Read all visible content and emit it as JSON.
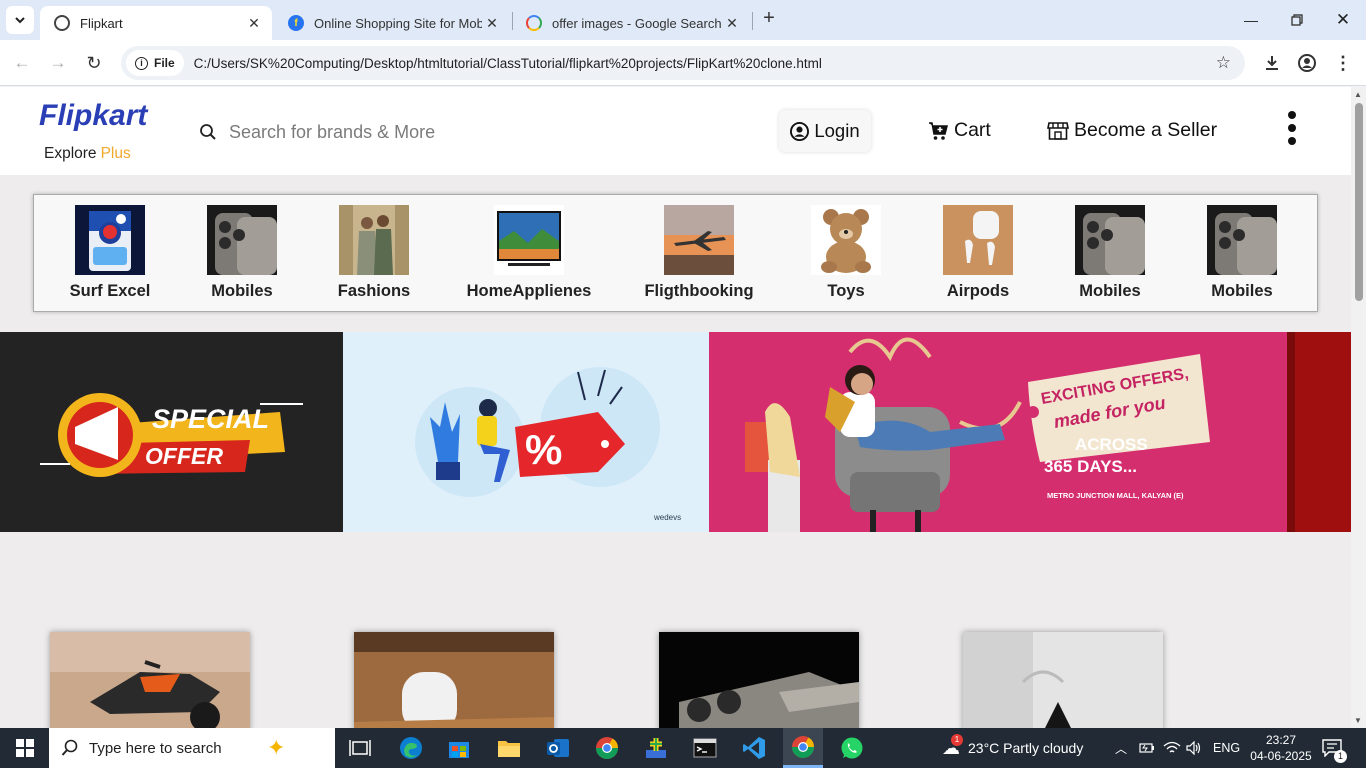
{
  "browser": {
    "tabs": [
      {
        "title": "Flipkart",
        "active": true
      },
      {
        "title": "Online Shopping Site for Mobile",
        "active": false
      },
      {
        "title": "offer images - Google Search",
        "active": false
      }
    ],
    "address": {
      "chip_label": "File",
      "url": "C:/Users/SK%20Computing/Desktop/htmltutorial/ClassTutorial/flipkart%20projects/FlipKart%20clone.html"
    }
  },
  "site": {
    "logo": "Flipkart",
    "explore": "Explore",
    "plus": "Plus",
    "search_placeholder": "Search for brands & More",
    "login_label": "Login",
    "cart_label": "Cart",
    "seller_label": "Become a Seller",
    "categories": [
      {
        "label": "Surf Excel"
      },
      {
        "label": "Mobiles"
      },
      {
        "label": "Fashions"
      },
      {
        "label": "HomeApplienes"
      },
      {
        "label": "Fligthbooking"
      },
      {
        "label": "Toys"
      },
      {
        "label": "Airpods"
      },
      {
        "label": "Mobiles"
      },
      {
        "label": "Mobiles"
      }
    ],
    "banners": {
      "special_line1": "SPECIAL",
      "special_line2": "OFFER",
      "discount_symbol": "%",
      "wedevs": "wedevs",
      "exciting_line1": "EXCITING OFFERS,",
      "exciting_line2": "made for you",
      "across_line1": "ACROSS",
      "across_line2": "365 DAYS...",
      "mall": "METRO JUNCTION MALL, KALYAN (E)"
    }
  },
  "taskbar": {
    "search_placeholder": "Type here to search",
    "weather": "23°C  Partly cloudy",
    "weather_badge": "1",
    "language": "ENG",
    "time": "23:27",
    "date": "04-06-2025",
    "notification_count": "1"
  },
  "colors": {
    "brand_blue": "#2a3fb5",
    "plus_yellow": "#f0a92b",
    "taskbar": "#222b35",
    "tabbar": "#dfe9f7"
  }
}
